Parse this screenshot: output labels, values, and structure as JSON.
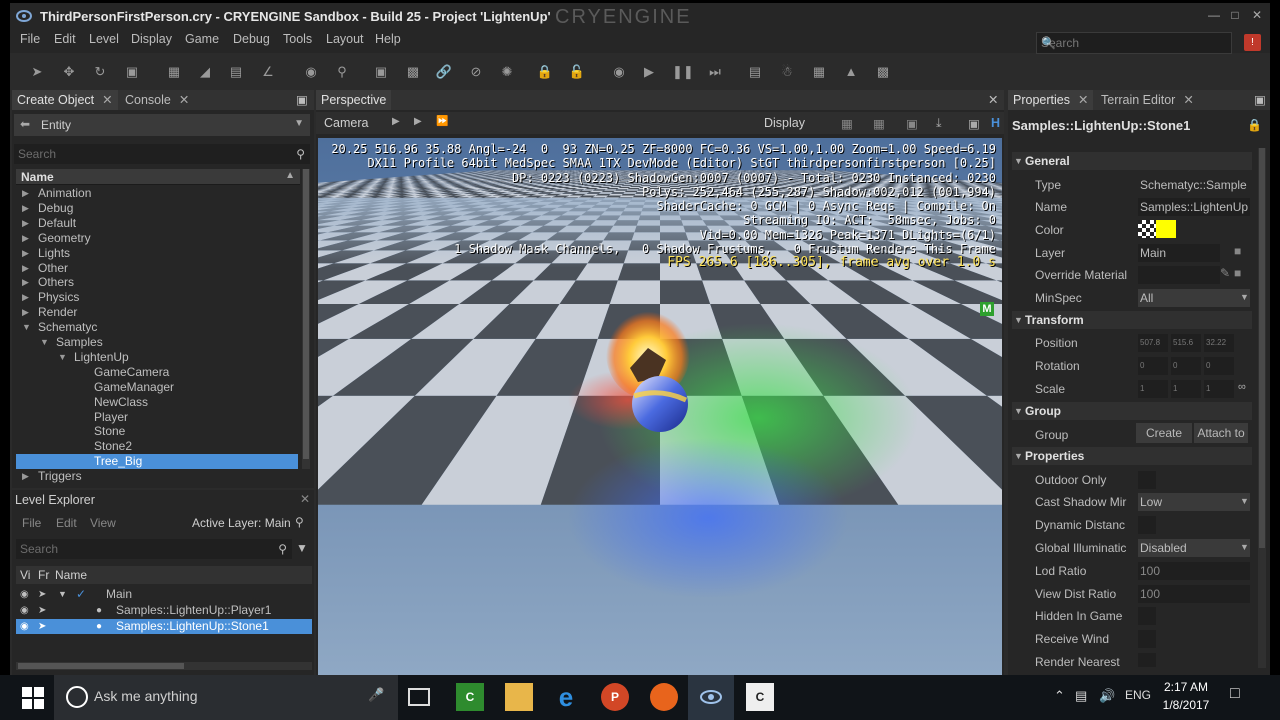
{
  "window": {
    "title": "ThirdPersonFirstPerson.cry - CRYENGINE Sandbox - Build 25 - Project 'LightenUp'",
    "brand": "CRYENGINE"
  },
  "menu": [
    "File",
    "Edit",
    "Level",
    "Display",
    "Game",
    "Debug",
    "Tools",
    "Layout",
    "Help"
  ],
  "top_search": {
    "placeholder": "Search"
  },
  "create_object": {
    "tabs": [
      "Create Object",
      "Console"
    ],
    "category": "Entity",
    "search_placeholder": "Search",
    "column_name": "Name",
    "tree": [
      {
        "label": "Animation",
        "depth": 0,
        "expanded": false
      },
      {
        "label": "Debug",
        "depth": 0,
        "expanded": false
      },
      {
        "label": "Default",
        "depth": 0,
        "expanded": false
      },
      {
        "label": "Geometry",
        "depth": 0,
        "expanded": false
      },
      {
        "label": "Lights",
        "depth": 0,
        "expanded": false
      },
      {
        "label": "Other",
        "depth": 0,
        "expanded": false
      },
      {
        "label": "Others",
        "depth": 0,
        "expanded": false
      },
      {
        "label": "Physics",
        "depth": 0,
        "expanded": false
      },
      {
        "label": "Render",
        "depth": 0,
        "expanded": false
      },
      {
        "label": "Schematyc",
        "depth": 0,
        "expanded": true
      },
      {
        "label": "Samples",
        "depth": 1,
        "expanded": true
      },
      {
        "label": "LightenUp",
        "depth": 2,
        "expanded": true
      },
      {
        "label": "GameCamera",
        "depth": 4,
        "leaf": true
      },
      {
        "label": "GameManager",
        "depth": 4,
        "leaf": true
      },
      {
        "label": "NewClass",
        "depth": 4,
        "leaf": true
      },
      {
        "label": "Player",
        "depth": 4,
        "leaf": true
      },
      {
        "label": "Stone",
        "depth": 4,
        "leaf": true
      },
      {
        "label": "Stone2",
        "depth": 4,
        "leaf": true
      },
      {
        "label": "Tree_Big",
        "depth": 4,
        "leaf": true,
        "selected": true
      },
      {
        "label": "Triggers",
        "depth": 0,
        "expanded": false
      }
    ]
  },
  "level_explorer": {
    "title": "Level Explorer",
    "menus": [
      "File",
      "Edit",
      "View"
    ],
    "active_layer": "Active Layer: Main",
    "search_placeholder": "Search",
    "columns": [
      "Vi",
      "Fr",
      "Name"
    ],
    "rows": [
      {
        "name": "Main",
        "selected": false
      },
      {
        "name": "Samples::LightenUp::Player1",
        "selected": false
      },
      {
        "name": "Samples::LightenUp::Stone1",
        "selected": true
      }
    ]
  },
  "perspective": {
    "title": "Perspective",
    "camera_label": "Camera",
    "display_label": "Display",
    "stats": [
      "20.25 516.96 35.88 Angl=-24  0  93 ZN=0.25 ZF=8000 FC=0.36 VS=1.00,1.00 Zoom=1.00 Speed=6.19",
      "DX11 Profile 64bit MedSpec SMAA 1TX DevMode (Editor) StGT thirdpersonfirstperson [0.25]",
      "DP: 0223 (0223) ShadowGen:0007 (0007) - Total: 0230 Instanced: 0230",
      "Polys: 252,464 (255,287) Shadow:002,012 (001,994)",
      "ShaderCache: 0 GCM | 0 Async Reqs | Compile: On",
      "Streaming IO: ACT:  58msec, Jobs: 0",
      "Vid=0.00 Mem=1326 Peak=1371 DLights=(6/1)",
      "1 Shadow Mask Channels,   0 Shadow Frustums,   0 Frustum Renders This Frame"
    ],
    "fps_line": "FPS 265.6 [186..305], frame avg over 1.0 s",
    "badge": "M"
  },
  "properties": {
    "tabs": [
      "Properties",
      "Terrain Editor"
    ],
    "object_name": "Samples::LightenUp::Stone1",
    "sections": {
      "general": "General",
      "transform": "Transform",
      "group": "Group",
      "properties": "Properties"
    },
    "general": {
      "type_label": "Type",
      "type_value": "Schematyc::Sample",
      "name_label": "Name",
      "name_value": "Samples::LightenUp",
      "color_label": "Color",
      "color_value": "#ffff00",
      "layer_label": "Layer",
      "layer_value": "Main",
      "override_label": "Override Material",
      "minspec_label": "MinSpec",
      "minspec_value": "All"
    },
    "transform": {
      "position_label": "Position",
      "position_values": [
        "507.8",
        "515.6",
        "32.22"
      ],
      "rotation_label": "Rotation",
      "rotation_values": [
        "0",
        "0",
        "0"
      ],
      "scale_label": "Scale",
      "scale_values": [
        "1",
        "1",
        "1"
      ]
    },
    "group": {
      "group_label": "Group",
      "create_btn": "Create",
      "attach_btn": "Attach to"
    },
    "props": {
      "outdoor_only": "Outdoor Only",
      "cast_shadow": "Cast Shadow Mir",
      "cast_shadow_value": "Low",
      "dynamic_dist": "Dynamic Distanc",
      "global_illum": "Global Illuminatic",
      "global_illum_value": "Disabled",
      "lod_ratio": "Lod Ratio",
      "lod_ratio_value": "100",
      "view_dist": "View Dist Ratio",
      "view_dist_value": "100",
      "hidden_in_game": "Hidden In Game",
      "receive_wind": "Receive Wind",
      "render_nearest": "Render Nearest"
    }
  },
  "taskbar": {
    "search_text": "Ask me anything",
    "language": "ENG",
    "time": "2:17 AM",
    "date": "1/8/2017"
  },
  "colors": {
    "accent": "#4a90d9",
    "panel": "#262626",
    "taskbar": "#101418"
  }
}
